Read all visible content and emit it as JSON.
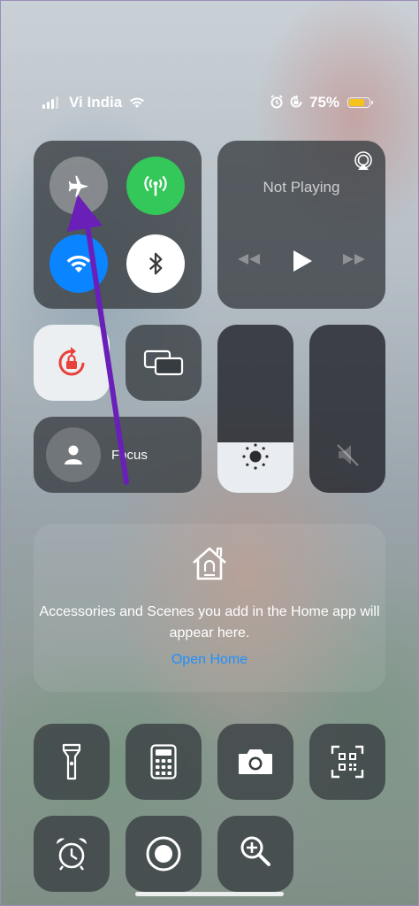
{
  "status_bar": {
    "carrier": "Vi India",
    "battery_percent": "75%",
    "battery_level": 0.75,
    "icons": [
      "signal-icon",
      "wifi-icon",
      "alarm-icon",
      "rotation-lock-icon",
      "battery-icon"
    ]
  },
  "connectivity": {
    "airplane": {
      "icon": "airplane-icon",
      "active": false
    },
    "cellular": {
      "icon": "cellular-antenna-icon",
      "active": true,
      "color": "#34c759"
    },
    "wifi": {
      "icon": "wifi-icon",
      "active": true,
      "color": "#0a84ff"
    },
    "bluetooth": {
      "icon": "bluetooth-icon",
      "active": true
    }
  },
  "media": {
    "title": "Not Playing",
    "icons": [
      "airplay-icon",
      "rewind-icon",
      "play-icon",
      "fast-forward-icon"
    ]
  },
  "focus": {
    "label": "Focus",
    "icon": "person-icon"
  },
  "brightness": {
    "level": 0.3,
    "icon": "sun-icon"
  },
  "volume": {
    "level": 0.0,
    "icon": "speaker-muted-icon"
  },
  "home": {
    "message": "Accessories and Scenes you add in the Home app will appear here.",
    "link": "Open Home",
    "icon": "home-icon",
    "link_color": "#1e90ff"
  },
  "controls": [
    {
      "icon": "flashlight-icon"
    },
    {
      "icon": "calculator-icon"
    },
    {
      "icon": "camera-icon"
    },
    {
      "icon": "qr-scanner-icon"
    },
    {
      "icon": "alarm-clock-icon"
    },
    {
      "icon": "screen-record-icon"
    },
    {
      "icon": "magnifier-icon"
    }
  ],
  "annotation": {
    "arrow_color": "#6a1fb8"
  }
}
